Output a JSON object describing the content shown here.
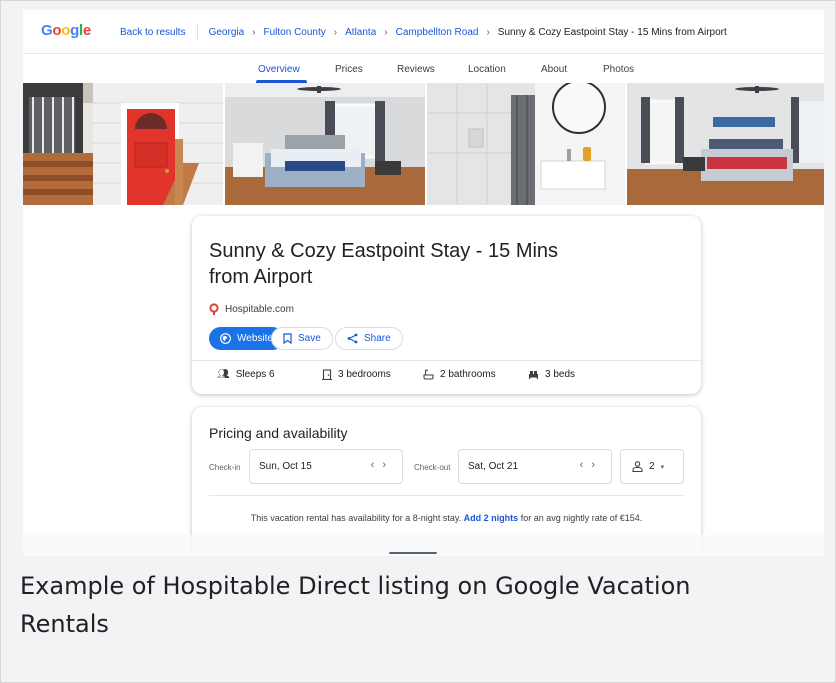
{
  "logo": {
    "letters": [
      "G",
      "o",
      "o",
      "g",
      "l",
      "e"
    ],
    "colors": [
      "#4285f4",
      "#ea4335",
      "#fbbc05",
      "#4285f4",
      "#34a853",
      "#ea4335"
    ]
  },
  "breadcrumbs": {
    "back": "Back to results",
    "items": [
      "Georgia",
      "Fulton County",
      "Atlanta",
      "Campbellton Road"
    ],
    "current": "Sunny & Cozy Eastpoint Stay - 15 Mins from Airport"
  },
  "tabs": [
    "Overview",
    "Prices",
    "Reviews",
    "Location",
    "About",
    "Photos"
  ],
  "active_tab": "Overview",
  "listing": {
    "title": "Sunny & Cozy Eastpoint Stay - 15 Mins from Airport",
    "source": "Hospitable.com",
    "buttons": {
      "website": "Website",
      "save": "Save",
      "share": "Share"
    },
    "amenities": {
      "sleeps": "Sleeps 6",
      "bedrooms": "3 bedrooms",
      "bathrooms": "2 bathrooms",
      "beds": "3 beds"
    }
  },
  "pricing": {
    "title": "Pricing and availability",
    "checkin_label": "Check-in",
    "checkin_value": "Sun, Oct 15",
    "checkout_label": "Check-out",
    "checkout_value": "Sat, Oct 21",
    "guests": "2",
    "availability_pre": "This vacation rental has availability for a 8-night stay.",
    "availability_link": "Add 2 nights",
    "availability_post": "for an avg nightly rate of €154."
  },
  "caption": "Example of Hospitable Direct listing on Google Vacation Rentals",
  "colors": {
    "accent": "#1a73e8",
    "link": "#1a56d6",
    "door": "#e3342b"
  }
}
